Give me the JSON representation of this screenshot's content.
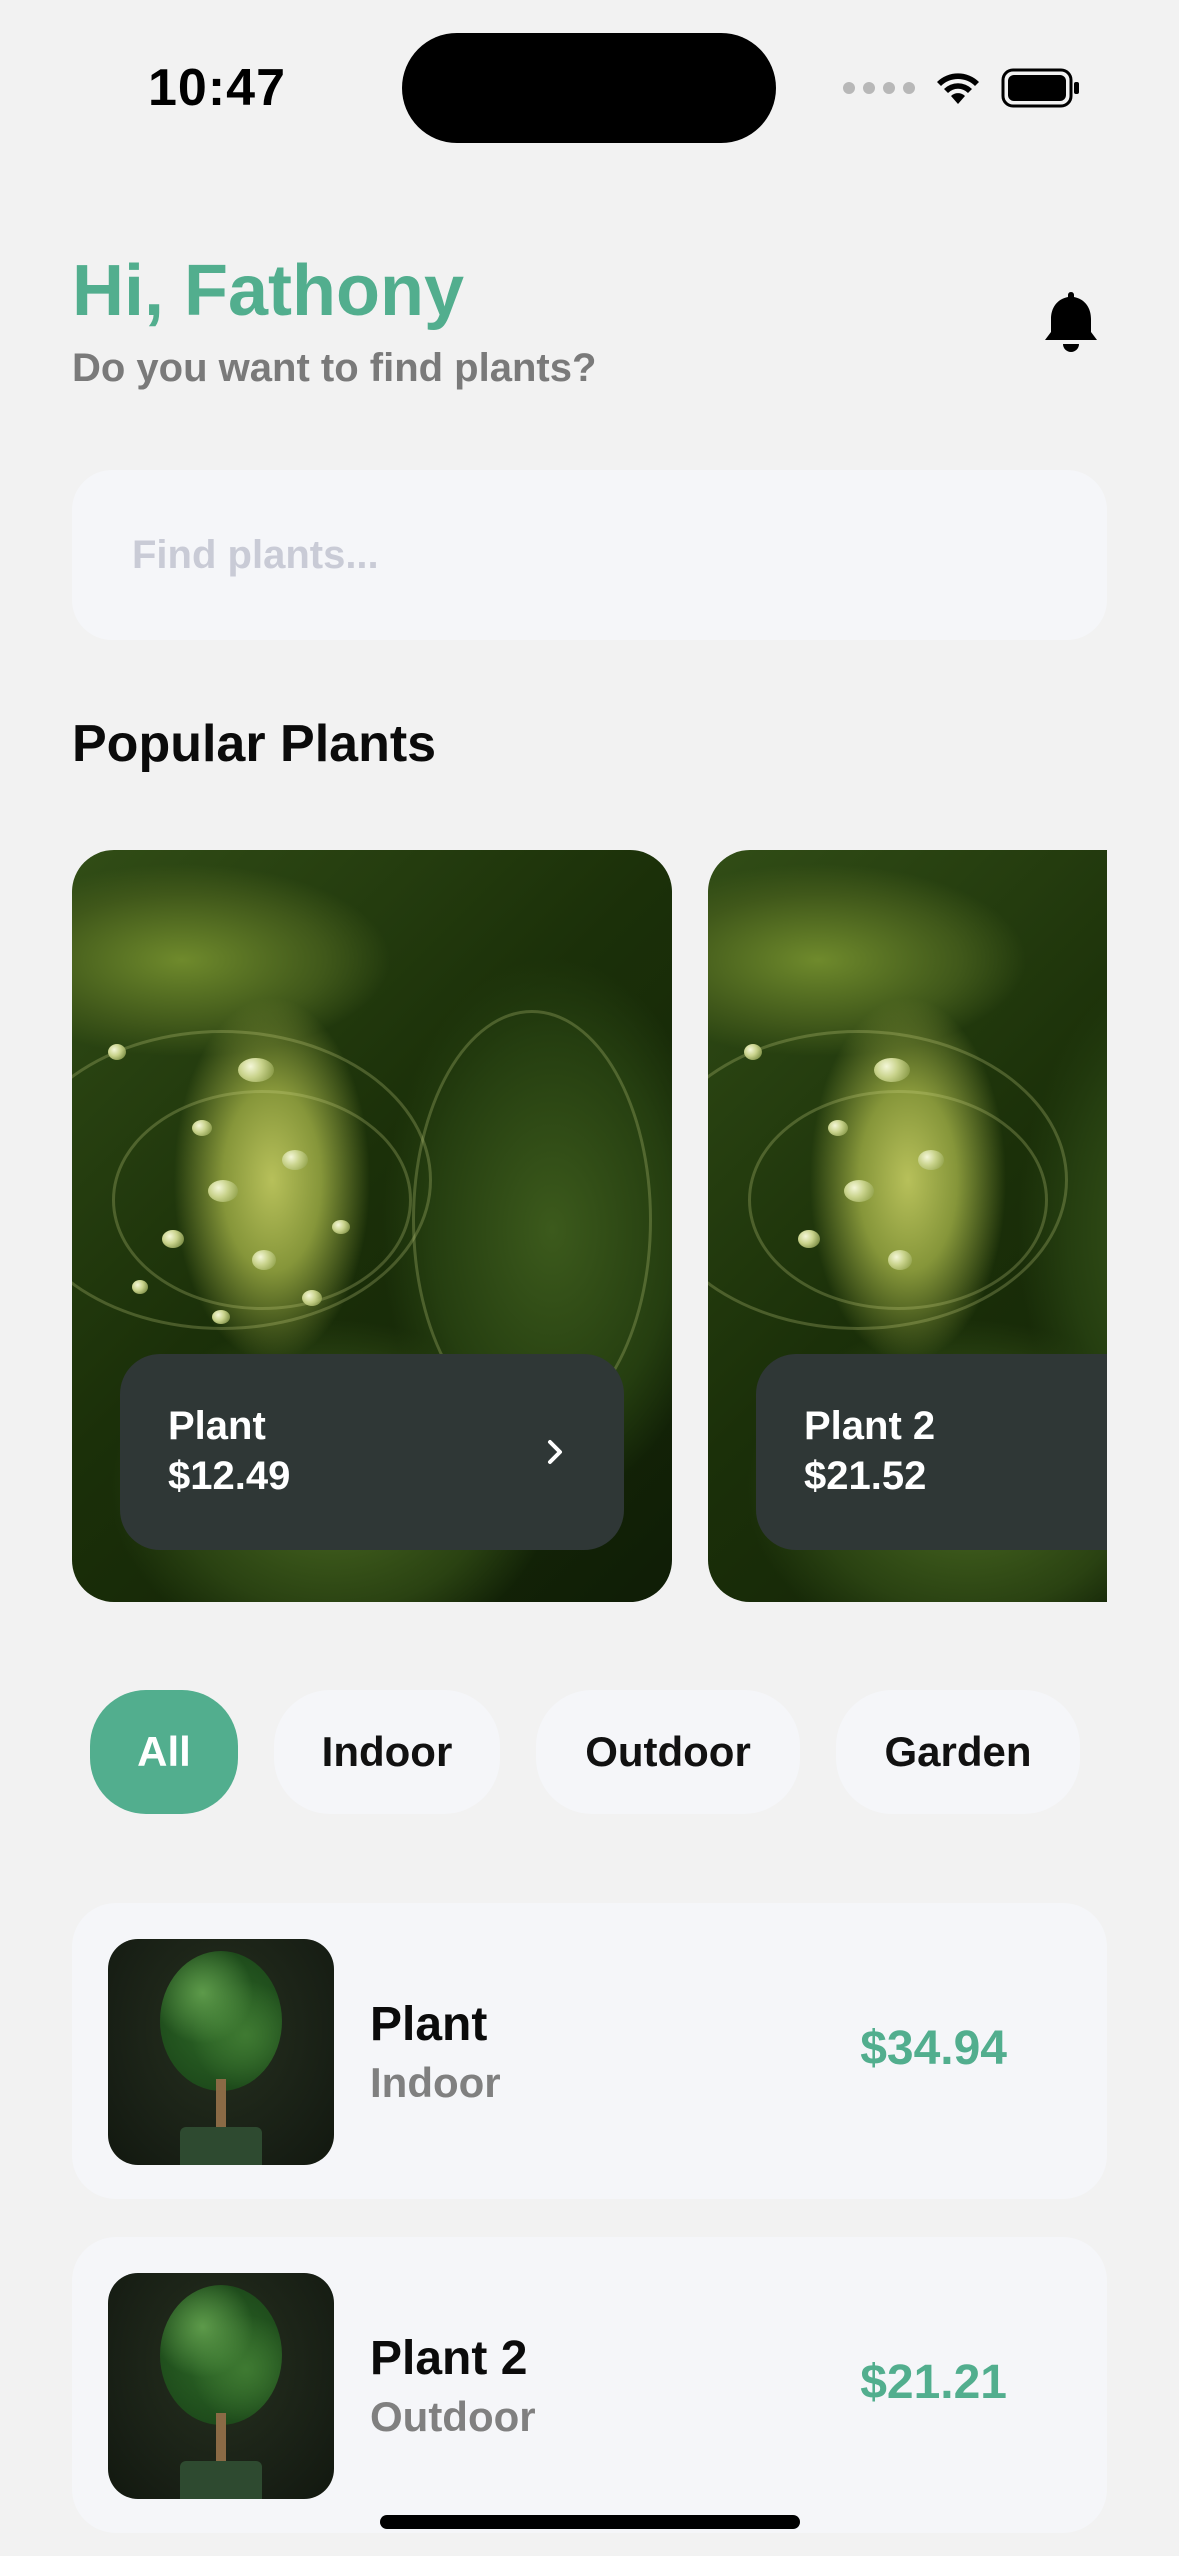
{
  "status_bar": {
    "time": "10:47",
    "wifi_icon": "wifi-icon",
    "battery_icon": "battery-icon"
  },
  "header": {
    "greeting": "Hi, Fathony",
    "subtitle": "Do you want to find plants?",
    "bell_icon": "bell-icon"
  },
  "search": {
    "placeholder": "Find plants...",
    "value": ""
  },
  "popular": {
    "title": "Popular Plants",
    "cards": [
      {
        "name": "Plant",
        "price": "$12.49"
      },
      {
        "name": "Plant 2",
        "price": "$21.52"
      }
    ]
  },
  "categories": {
    "items": [
      "All",
      "Indoor",
      "Outdoor",
      "Garden"
    ],
    "selected": "All"
  },
  "plant_list": [
    {
      "name": "Plant",
      "category": "Indoor",
      "price": "$34.94"
    },
    {
      "name": "Plant 2",
      "category": "Outdoor",
      "price": "$21.21"
    }
  ],
  "colors": {
    "accent": "#52ae8e",
    "background": "#f2f2f2",
    "card": "#f5f6f9",
    "label_dark": "#2f3736"
  }
}
